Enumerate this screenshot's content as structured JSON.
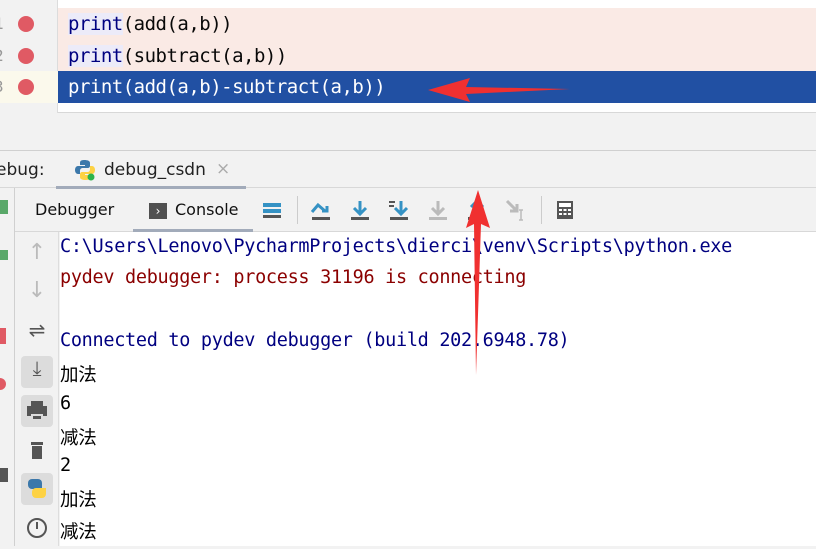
{
  "editor": {
    "lines": [
      {
        "number": "1",
        "kw": "print",
        "rest": "(add(a,b))",
        "breakpoint": true,
        "selected": false
      },
      {
        "number": "2",
        "kw": "print",
        "rest": "(subtract(a,b))",
        "breakpoint": true,
        "selected": false
      },
      {
        "number": "3",
        "kw": "print",
        "rest": "(add(a,b)-subtract(a,b))",
        "breakpoint": true,
        "selected": true
      }
    ]
  },
  "debug_panel": {
    "label": "ebug:",
    "tab": "debug_csdn",
    "close": "×"
  },
  "toolbar": {
    "debugger_tab": "Debugger",
    "console_tab": "Console",
    "icons": [
      "show-execution-point-icon",
      "step-over-icon",
      "step-into-icon",
      "step-into-my-code-icon",
      "force-step-into-icon",
      "step-out-icon",
      "run-to-cursor-icon",
      "evaluate-expression-icon"
    ]
  },
  "console": {
    "lines": [
      {
        "text": "C:\\Users\\Lenovo\\PycharmProjects\\dierci\\venv\\Scripts\\python.exe",
        "color": "#000080"
      },
      {
        "text": "pydev debugger: process 31196 is connecting",
        "color": "#8b0000"
      },
      {
        "text": "",
        "color": "#000"
      },
      {
        "text": "Connected to pydev debugger (build 202.6948.78)",
        "color": "#000080"
      },
      {
        "text": "加法",
        "color": "#000"
      },
      {
        "text": "6",
        "color": "#000"
      },
      {
        "text": "减法",
        "color": "#000"
      },
      {
        "text": "2",
        "color": "#000"
      },
      {
        "text": "加法",
        "color": "#000"
      },
      {
        "text": "减法",
        "color": "#000"
      }
    ]
  },
  "colors": {
    "selection": "#2150a3",
    "breakpoint": "#e05a64",
    "annotation_arrow": "#f03030",
    "icon_blue": "#3592c4"
  }
}
